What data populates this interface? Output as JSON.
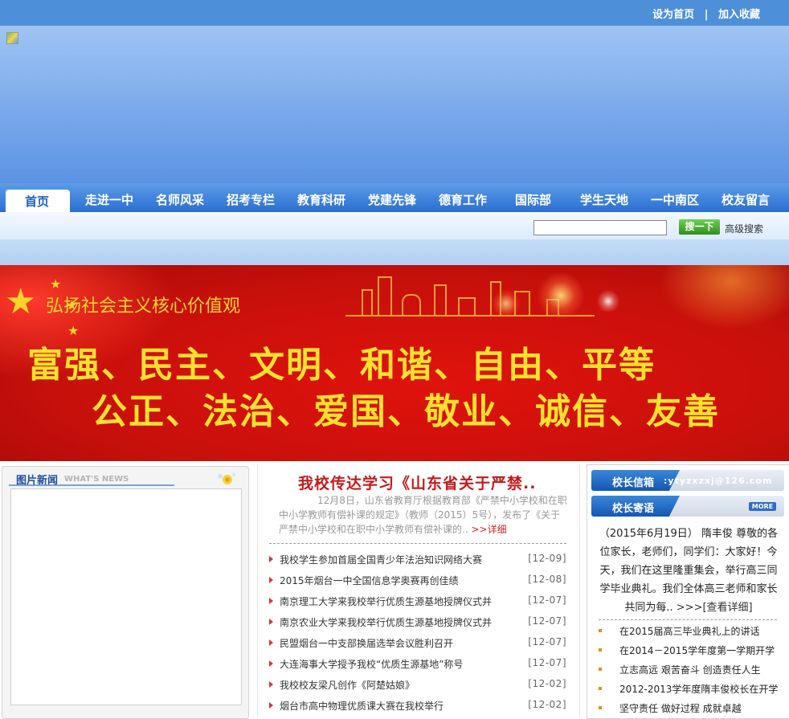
{
  "top_links": {
    "set_home": "设为首页",
    "separator": "|",
    "add_favorite": "加入收藏"
  },
  "nav": {
    "items": [
      "首页",
      "走进一中",
      "名师风采",
      "招考专栏",
      "教育科研",
      "党建先锋",
      "德育工作",
      "国际部",
      "学生天地",
      "一中南区",
      "校友留言"
    ],
    "active": "首页"
  },
  "search": {
    "value": "",
    "button": "搜一下",
    "advanced": "高级搜索"
  },
  "banner": {
    "slogan": "弘扬社会主义核心价值观",
    "line1": "富强、民主、文明、和谐、自由、平等",
    "line2": "公正、法治、爱国、敬业、诚信、友善"
  },
  "photo_news": {
    "title": "图片新闻",
    "subtitle": "WHAT'S NEWS"
  },
  "headline": {
    "title": "我校传达学习《山东省关于严禁..",
    "summary": "12月8日，山东省教育厅根据教育部《严禁中小学校和在职中小学教师有偿补课的规定》（教师（2015）5号），发布了《关于严禁中小学校和在职中小学教师有偿补课的..",
    "more": ">>详细"
  },
  "news": [
    {
      "title": "我校学生参加首届全国青少年法治知识网络大赛",
      "date": "[12-09]"
    },
    {
      "title": "2015年烟台一中全国信息学奥赛再创佳绩",
      "date": "[12-08]"
    },
    {
      "title": "南京理工大学来我校举行优质生源基地授牌仪式并",
      "date": "[12-07]"
    },
    {
      "title": "南京农业大学来我校举行优质生源基地授牌仪式并",
      "date": "[12-07]"
    },
    {
      "title": "民盟烟台一中支部换届选举会议胜利召开",
      "date": "[12-07]"
    },
    {
      "title": "大连海事大学授予我校“优质生源基地”称号",
      "date": "[12-07]"
    },
    {
      "title": "我校校友梁凡创作《阿楚姑娘》",
      "date": "[12-02]"
    },
    {
      "title": "烟台市高中物理优质课大赛在我校举行",
      "date": "[12-02]"
    }
  ],
  "principal_mailbox": {
    "label": "校长信箱",
    "email": ":ytyzxzxj@126.com"
  },
  "principal_message": {
    "label": "校长寄语",
    "more": "MORE",
    "text": "（2015年6月19日） 隋丰俊 尊敬的各位家长，老师们，同学们：大家好！今天，我们在这里隆重集会，举行高三同学毕业典礼。我们全体高三老师和家长共同为每..",
    "detail": ">>>[查看详细]"
  },
  "principal_articles": [
    "在2015届高三毕业典礼上的讲话",
    "在2014－2015学年度第一学期开学",
    "立志高远 艰苦奋斗 创造责任人生",
    "2012-2013学年度隋丰俊校长在开学",
    "坚守责任 做好过程 成就卓越"
  ],
  "colors": {
    "nav_blue": "#2b6fd1",
    "banner_red": "#c8100b",
    "slogan_yellow": "#fbe22c",
    "headline_red": "#c41a1a"
  }
}
